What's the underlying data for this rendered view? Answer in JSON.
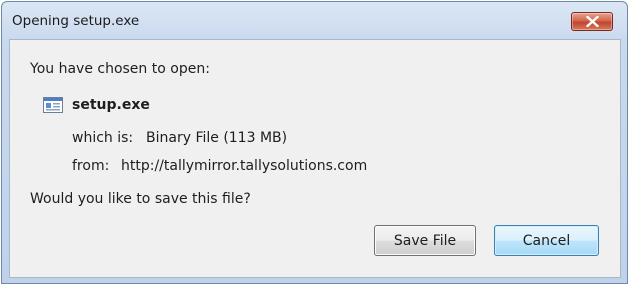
{
  "dialog": {
    "title": "Opening setup.exe",
    "intro": "You have chosen to open:",
    "file_icon": "executable-file-icon",
    "filename": "setup.exe",
    "which_is_label": "which is:",
    "which_is_value": "Binary File (113 MB)",
    "from_label": "from:",
    "from_value": "http://tallymirror.tallysolutions.com",
    "question": "Would you like to save this file?",
    "save_button": "Save File",
    "cancel_button": "Cancel",
    "close_icon": "close-icon"
  }
}
